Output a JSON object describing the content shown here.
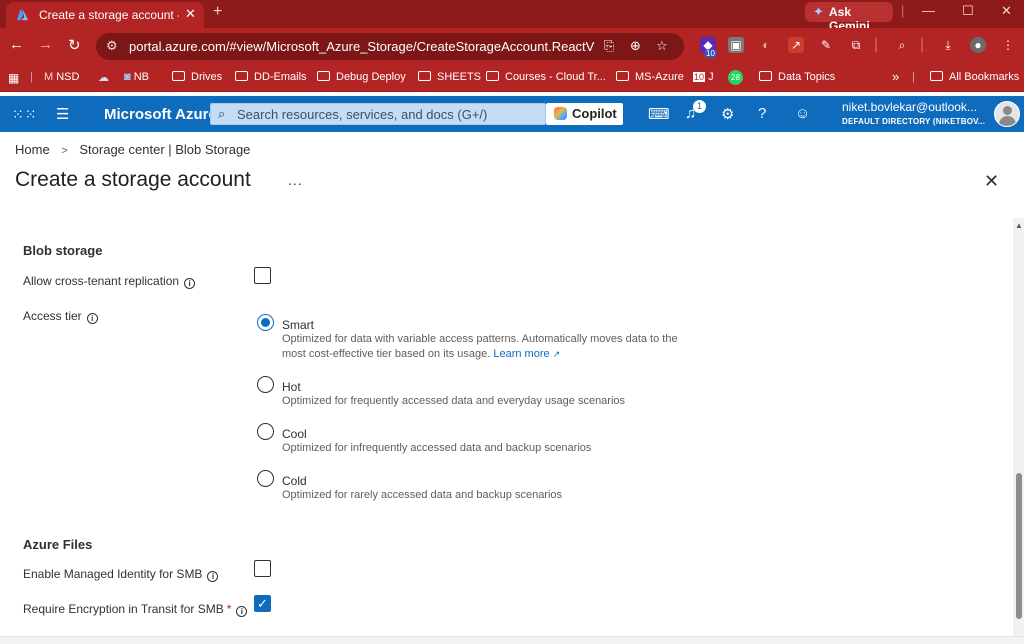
{
  "browser": {
    "tab_title": "Create a storage account - Micr",
    "new_tab": "+",
    "gemini_label": "Ask Gemini",
    "url": "portal.azure.com/#view/Microsoft_Azure_Storage/CreateStorageAccount.ReactView/_pr...",
    "ext_badge_1": "10",
    "ext_badge_2": "28",
    "bookmarks": [
      "NSD",
      "NB",
      "Drives",
      "DD-Emails",
      "Debug Deploy",
      "SHEETS",
      "Courses - Cloud Tr...",
      "MS-Azure",
      "J",
      "Data Topics"
    ],
    "more_bookmarks": "»",
    "all_bookmarks": "All Bookmarks"
  },
  "azure": {
    "brand": "Microsoft Azure",
    "search_placeholder": "Search resources, services, and docs (G+/)",
    "copilot_label": "Copilot",
    "notification_count": "1",
    "user_email": "niket.bovlekar@outlook...",
    "user_directory": "DEFAULT DIRECTORY (NIKETBOV..."
  },
  "page": {
    "breadcrumb_home": "Home",
    "breadcrumb_current": "Storage center | Blob Storage",
    "title": "Create a storage account",
    "more": "...",
    "close": "✕"
  },
  "blob_storage": {
    "section_title": "Blob storage",
    "cross_tenant_label": "Allow cross-tenant replication",
    "cross_tenant_checked": false,
    "access_tier_label": "Access tier",
    "selected_tier": "Smart",
    "tiers": [
      {
        "name": "Smart",
        "desc": "Optimized for data with variable access patterns. Automatically moves data to the most cost-effective tier based on its usage.",
        "link": "Learn more"
      },
      {
        "name": "Hot",
        "desc": "Optimized for frequently accessed data and everyday usage scenarios"
      },
      {
        "name": "Cool",
        "desc": "Optimized for infrequently accessed data and backup scenarios"
      },
      {
        "name": "Cold",
        "desc": "Optimized for rarely accessed data and backup scenarios"
      }
    ]
  },
  "azure_files": {
    "section_title": "Azure Files",
    "managed_identity_label": "Enable Managed Identity for SMB",
    "managed_identity_checked": false,
    "encryption_label": "Require Encryption in Transit for SMB",
    "encryption_required_mark": "*",
    "encryption_checked": true
  },
  "colors": {
    "browser_red": "#b32424",
    "azure_blue": "#0f6cbd",
    "link_blue": "#0f6cbd"
  }
}
